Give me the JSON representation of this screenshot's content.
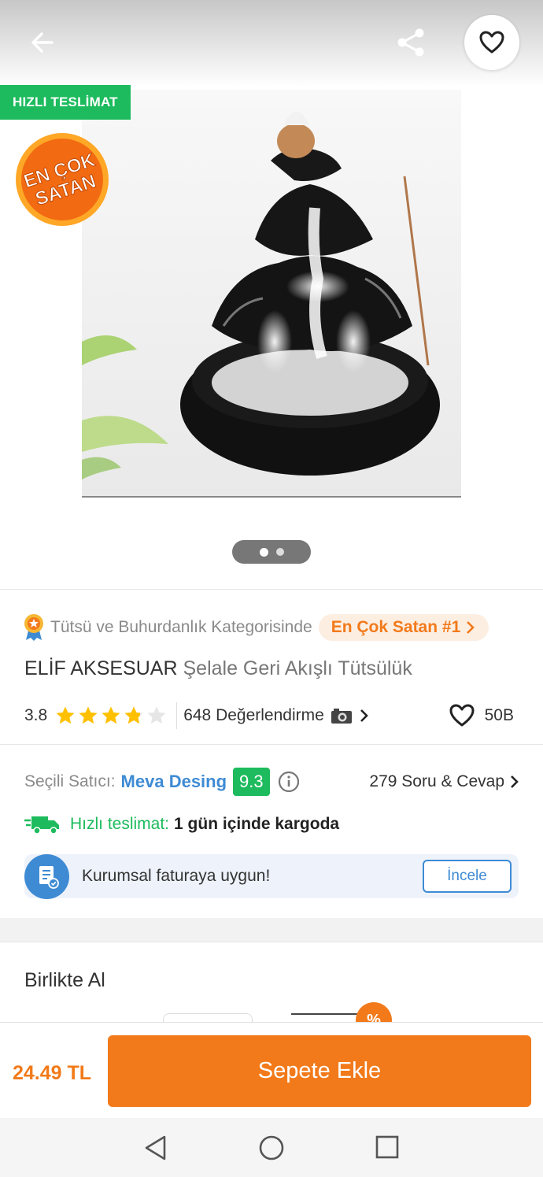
{
  "header": {
    "back_icon": "arrow-left-icon",
    "share_icon": "share-icon",
    "favorite_icon": "heart-outline-icon"
  },
  "gallery": {
    "fast_delivery_badge": "HIZLI TESLİMAT",
    "bestseller_badge": "EN ÇOK SATAN",
    "current_image": 1,
    "total_images": 2
  },
  "category": {
    "text": "Tütsü ve Buhurdanlık Kategorisinde",
    "rank_label": "En Çok Satan #1"
  },
  "product": {
    "brand": "ELİF AKSESUAR",
    "name": "Şelale Geri Akışlı Tütsülük"
  },
  "rating": {
    "value": "3.8",
    "stars": 3.8,
    "reviews": "648 Değerlendirme",
    "favorites": "50B"
  },
  "seller": {
    "label": "Seçili Satıcı:",
    "name": "Meva Desing",
    "score": "9.3",
    "qa": "279 Soru & Cevap"
  },
  "delivery": {
    "label": "Hızlı teslimat:",
    "value": "1 gün içinde kargoda"
  },
  "invoice": {
    "text": "Kurumsal faturaya uygun!",
    "button": "İncele"
  },
  "bundle": {
    "title": "Birlikte Al",
    "discount_symbol": "%"
  },
  "bottom": {
    "price": "24.49 TL",
    "add_to_cart": "Sepete Ekle"
  },
  "colors": {
    "brand_orange": "#f27a1a",
    "success_green": "#1dbb5d",
    "link_blue": "#3e8bd4"
  }
}
